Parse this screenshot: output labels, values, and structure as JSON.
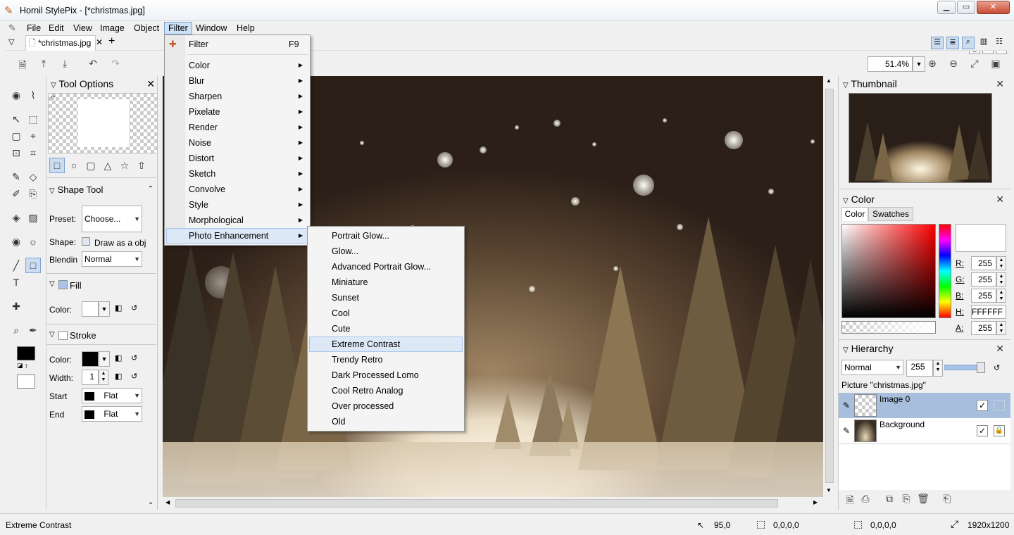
{
  "window": {
    "title": "Hornil StylePix - [*christmas.jpg]"
  },
  "menubar": [
    "File",
    "Edit",
    "View",
    "Image",
    "Object",
    "Filter",
    "Window",
    "Help"
  ],
  "tabs": [
    {
      "label": "*christmas.jpg"
    }
  ],
  "toolbar": {
    "zoom": "51.4%"
  },
  "tool_options": {
    "title": "Tool Options",
    "shape_tool": "Shape Tool",
    "preset_label": "Preset:",
    "preset_value": "Choose...",
    "shape_label": "Shape:",
    "shape_check": "Draw as a obj",
    "blend_label": "Blendin",
    "blend_value": "Normal",
    "fill_label": "Fill",
    "fill_color_label": "Color:",
    "stroke_label": "Stroke",
    "stroke_color_label": "Color:",
    "width_label": "Width:",
    "width_value": "1",
    "start_label": "Start",
    "start_value": "Flat",
    "end_label": "End",
    "end_value": "Flat"
  },
  "filter_menu": {
    "top": {
      "label": "Filter",
      "shortcut": "F9"
    },
    "items": [
      "Color",
      "Blur",
      "Sharpen",
      "Pixelate",
      "Render",
      "Noise",
      "Distort",
      "Sketch",
      "Convolve",
      "Style",
      "Morphological",
      "Photo Enhancement"
    ]
  },
  "photo_enhancement_menu": [
    "Portrait Glow...",
    "Glow...",
    "Advanced Portrait Glow...",
    "Miniature",
    "Sunset",
    "Cool",
    "Cute",
    "Extreme Contrast",
    "Trendy Retro",
    "Dark Processed Lomo",
    "Cool Retro Analog",
    "Over processed",
    "Old"
  ],
  "highlighted": "Extreme Contrast",
  "thumbnail_panel": {
    "title": "Thumbnail"
  },
  "color_panel": {
    "title": "Color",
    "tabs": [
      "Color",
      "Swatches"
    ],
    "r_label": "R:",
    "r": "255",
    "g_label": "G:",
    "g": "255",
    "b_label": "B:",
    "b": "255",
    "h_label": "H:",
    "hex": "FFFFFF",
    "a_label": "A:",
    "a": "255"
  },
  "hierarchy_panel": {
    "title": "Hierarchy",
    "blend": "Normal",
    "opacity": "255",
    "picture": "Picture \"christmas.jpg\"",
    "layers": [
      {
        "name": "Image 0"
      },
      {
        "name": "Background"
      }
    ]
  },
  "statusbar": {
    "message": "Extreme Contrast",
    "cursor": "95,0",
    "selection": "0,0,0,0",
    "selection2": "0,0,0,0",
    "size": "1920x1200"
  },
  "colors": {
    "accent": "#cfe1f5",
    "highlight": "#dde8f6",
    "layer_selected": "#a7bfdc"
  }
}
